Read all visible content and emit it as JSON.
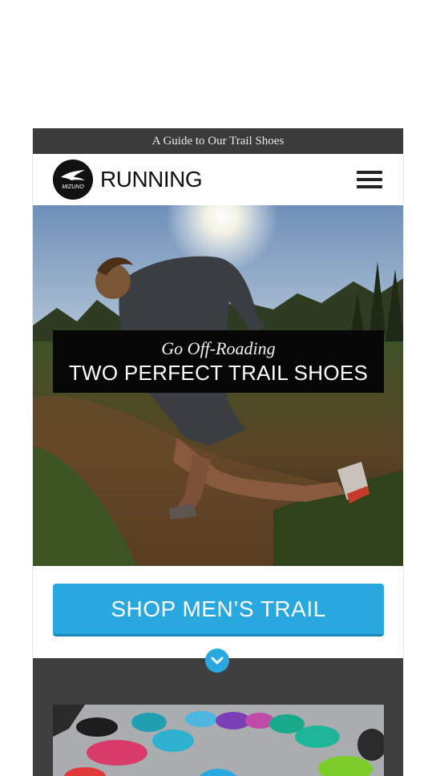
{
  "pre_header": {
    "text": "A Guide to Our Trail Shoes"
  },
  "header": {
    "logo_alt": "MIZUNO",
    "brand_label": "RUNNING",
    "menu_icon": "hamburger-menu-icon"
  },
  "hero": {
    "kicker": "Go Off-Roading",
    "title": "TWO PERFECT TRAIL SHOES"
  },
  "cta": {
    "label": "SHOP MEN’S TRAIL"
  },
  "scroll_icon": "chevron-down-icon",
  "colors": {
    "accent": "#29a8e0",
    "dark_bar": "#3b3b3b",
    "dark_section": "#3f3f3f"
  }
}
